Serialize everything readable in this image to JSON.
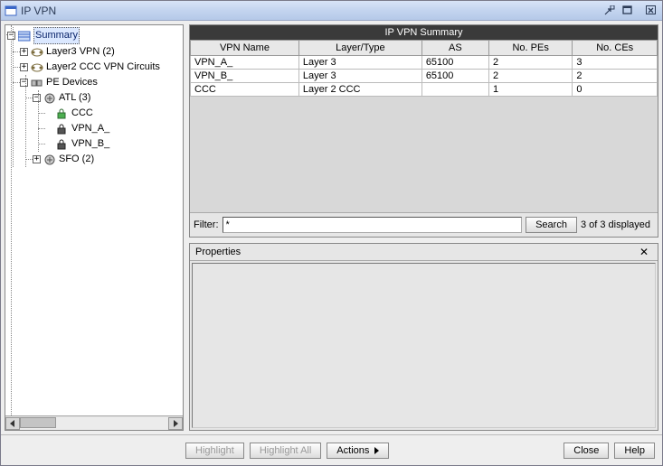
{
  "window": {
    "title": "IP VPN"
  },
  "tree": {
    "summary_label": "Summary",
    "layer3_label": "Layer3 VPN (2)",
    "layer2_label": "Layer2 CCC VPN Circuits",
    "pe_label": "PE Devices",
    "atl_label": "ATL (3)",
    "ccc_label": "CCC",
    "vpn_a_label": "VPN_A_",
    "vpn_b_label": "VPN_B_",
    "sfo_label": "SFO (2)"
  },
  "table": {
    "title": "IP VPN Summary",
    "headers": {
      "name": "VPN Name",
      "layer": "Layer/Type",
      "as": "AS",
      "pes": "No. PEs",
      "ces": "No. CEs"
    },
    "rows": [
      {
        "name": "VPN_A_",
        "layer": "Layer 3",
        "as": "65100",
        "pes": "2",
        "ces": "3"
      },
      {
        "name": "VPN_B_",
        "layer": "Layer 3",
        "as": "65100",
        "pes": "2",
        "ces": "2"
      },
      {
        "name": "CCC",
        "layer": "Layer 2 CCC",
        "as": "",
        "pes": "1",
        "ces": "0"
      }
    ]
  },
  "filter": {
    "label": "Filter:",
    "value": "*",
    "search_label": "Search",
    "status": "3 of 3 displayed"
  },
  "properties": {
    "title": "Properties"
  },
  "buttons": {
    "highlight": "Highlight",
    "highlight_all": "Highlight All",
    "actions": "Actions",
    "close": "Close",
    "help": "Help"
  },
  "chart_data": {
    "type": "table",
    "title": "IP VPN Summary",
    "columns": [
      "VPN Name",
      "Layer/Type",
      "AS",
      "No. PEs",
      "No. CEs"
    ],
    "rows": [
      [
        "VPN_A_",
        "Layer 3",
        "65100",
        2,
        3
      ],
      [
        "VPN_B_",
        "Layer 3",
        "65100",
        2,
        2
      ],
      [
        "CCC",
        "Layer 2 CCC",
        "",
        1,
        0
      ]
    ]
  }
}
